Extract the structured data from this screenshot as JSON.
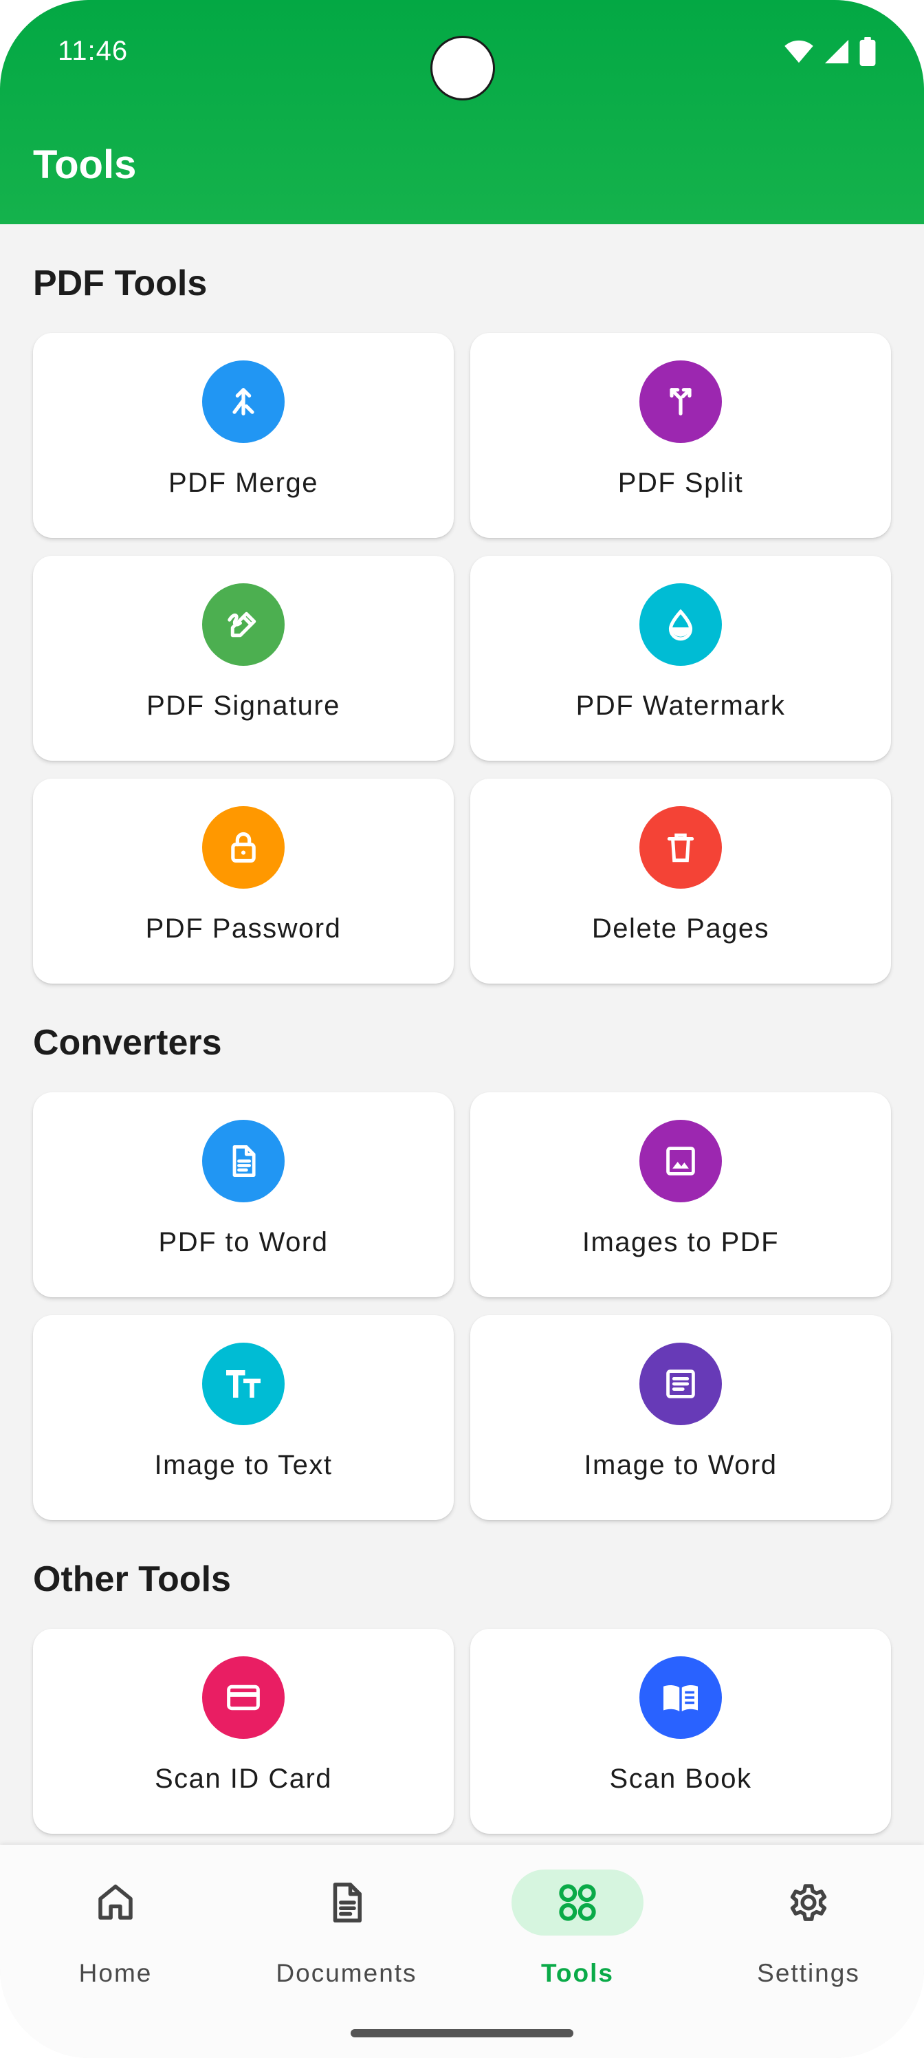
{
  "status_bar": {
    "time": "11:46"
  },
  "app_bar": {
    "title": "Tools",
    "color": "#03a844"
  },
  "sections": [
    {
      "title": "PDF Tools",
      "items": [
        {
          "label": "PDF Merge",
          "icon": "merge-icon",
          "color": "#2196f3"
        },
        {
          "label": "PDF Split",
          "icon": "split-icon",
          "color": "#9c27b0"
        },
        {
          "label": "PDF Signature",
          "icon": "signature-icon",
          "color": "#4caf50"
        },
        {
          "label": "PDF Watermark",
          "icon": "watermark-drop-icon",
          "color": "#00bcd4"
        },
        {
          "label": "PDF Password",
          "icon": "lock-icon",
          "color": "#ff9800"
        },
        {
          "label": "Delete Pages",
          "icon": "trash-icon",
          "color": "#f44336"
        }
      ]
    },
    {
      "title": "Converters",
      "items": [
        {
          "label": "PDF to Word",
          "icon": "document-icon",
          "color": "#2196f3"
        },
        {
          "label": "Images to PDF",
          "icon": "image-icon",
          "color": "#9c27b0"
        },
        {
          "label": "Image to Text",
          "icon": "text-format-icon",
          "color": "#00bcd4"
        },
        {
          "label": "Image to Word",
          "icon": "article-icon",
          "color": "#673ab7"
        }
      ]
    },
    {
      "title": "Other Tools",
      "items": [
        {
          "label": "Scan ID Card",
          "icon": "id-card-icon",
          "color": "#e91e63"
        },
        {
          "label": "Scan Book",
          "icon": "book-icon",
          "color": "#2962ff"
        }
      ]
    }
  ],
  "bottom_nav": {
    "items": [
      {
        "label": "Home",
        "icon": "home-icon"
      },
      {
        "label": "Documents",
        "icon": "documents-icon"
      },
      {
        "label": "Tools",
        "icon": "grid-icon",
        "active": true
      },
      {
        "label": "Settings",
        "icon": "gear-icon"
      }
    ],
    "active_color": "#0aaa48"
  }
}
